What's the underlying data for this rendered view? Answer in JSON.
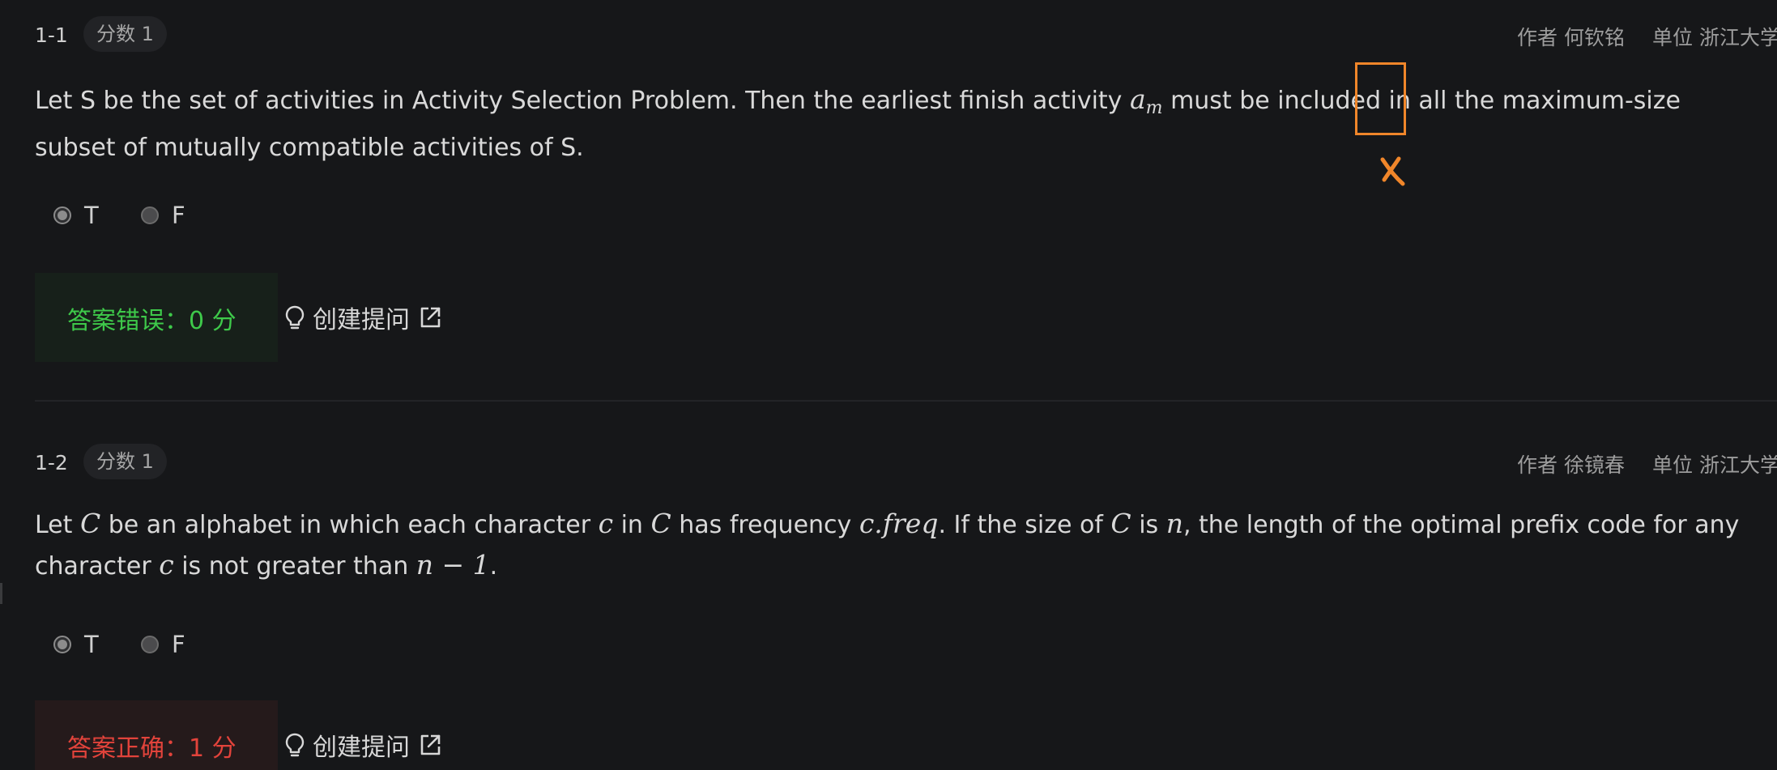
{
  "questions": [
    {
      "number": "1-1",
      "score_badge": "分数 1",
      "author": "作者 何钦铭",
      "unit": "单位 浙江大学",
      "text_parts": {
        "p1": "Let S be the set of activities in Activity Selection Problem. Then the earliest finish activity ",
        "math_a": "a",
        "math_m": "m",
        "p2": " must be included in all the maximum-size subset of mutually compatible activities of S."
      },
      "options": [
        {
          "label": "T",
          "selected": true
        },
        {
          "label": "F",
          "selected": false
        }
      ],
      "result": "答案错误：0 分",
      "result_color": "#3ec94a",
      "hint_label": "创建提问"
    },
    {
      "number": "1-2",
      "score_badge": "分数 1",
      "author": "作者 徐镜春",
      "unit": "单位 浙江大学",
      "text_parts": {
        "p1": "Let ",
        "m1": "C",
        "p2": " be an alphabet in which each character ",
        "m2": "c",
        "p3": " in ",
        "m3": "C",
        "p4": " has frequency ",
        "m4": "c.freq",
        "p5": ". If the size of ",
        "m5": "C",
        "p6": " is ",
        "m6": "n",
        "p7": ", the length of the optimal prefix code for any character ",
        "m7": "c",
        "p8": " is not greater than ",
        "m8": "n − 1",
        "p9": "."
      },
      "options": [
        {
          "label": "T",
          "selected": true
        },
        {
          "label": "F",
          "selected": false
        }
      ],
      "result": "答案正确：1 分",
      "result_color": "#e2433b",
      "hint_label": "创建提问"
    }
  ],
  "annotation": {
    "color": "#f0862a",
    "mark": "cross"
  },
  "icons": {
    "hint": "lightbulb-icon",
    "external": "external-link-icon"
  }
}
